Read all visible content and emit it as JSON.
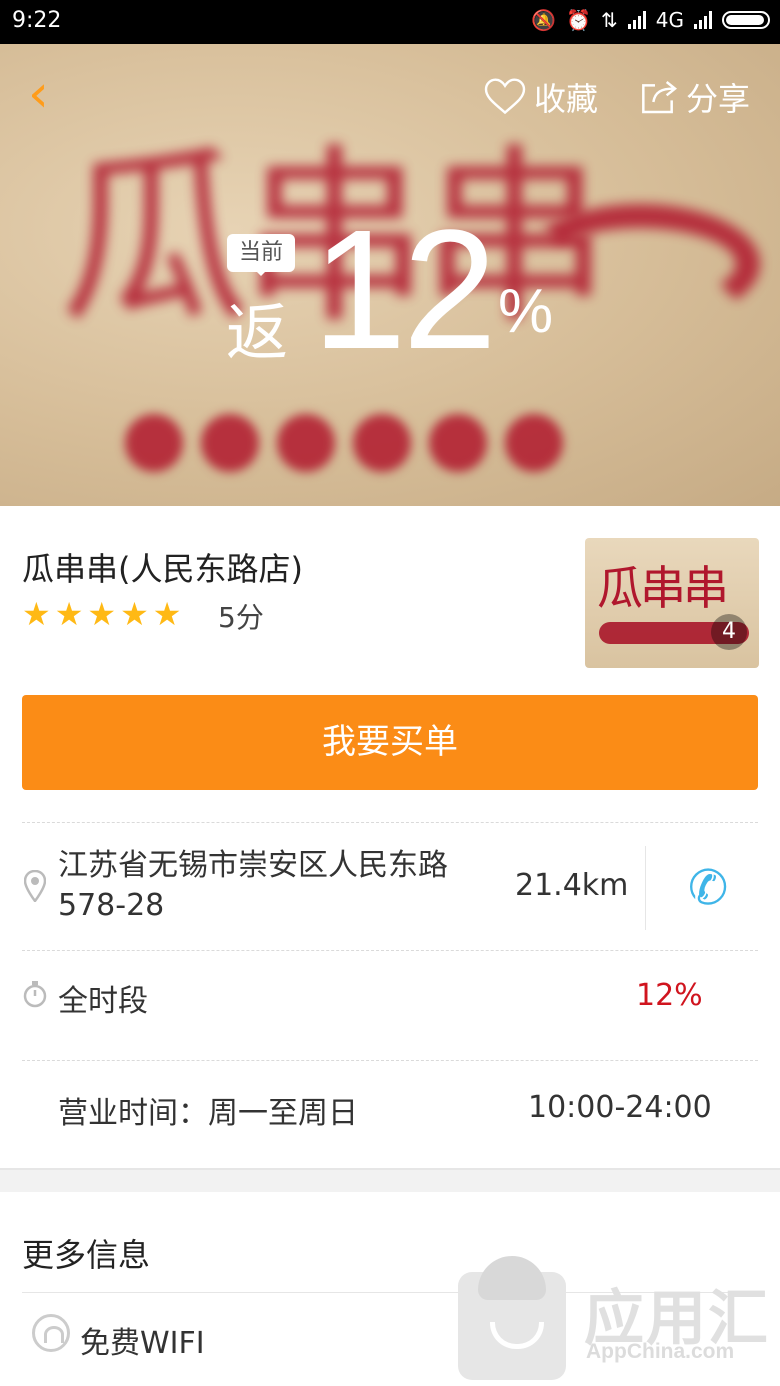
{
  "status_bar": {
    "time": "9:22",
    "network": "4G"
  },
  "header": {
    "favorite_label": "收藏",
    "share_label": "分享"
  },
  "hero": {
    "background_text": "瓜串串",
    "rebate_tag": "当前",
    "rebate_label": "返",
    "rebate_value": "12",
    "rebate_unit": "%"
  },
  "store": {
    "name": "瓜串串(人民东路店)",
    "rating": 5,
    "rating_text": "5分",
    "photo_text": "瓜串串",
    "photo_count": "4",
    "pay_button": "我要买单",
    "address": "江苏省无锡市崇安区人民东路578-28",
    "distance": "21.4km",
    "period_label": "全时段",
    "period_rate": "12%",
    "hours_label": "营业时间：周一至周日",
    "hours_value": "10:00-24:00"
  },
  "more_info": {
    "title": "更多信息",
    "wifi_label": "免费WIFI"
  },
  "watermark": {
    "title": "应用汇",
    "subtitle": "AppChina.com"
  },
  "colors": {
    "accent": "#fb8c16",
    "back_arrow": "#ff9c1a",
    "rate_red": "#d0141e",
    "phone_blue": "#3fb5e8",
    "star": "#ffb915"
  }
}
